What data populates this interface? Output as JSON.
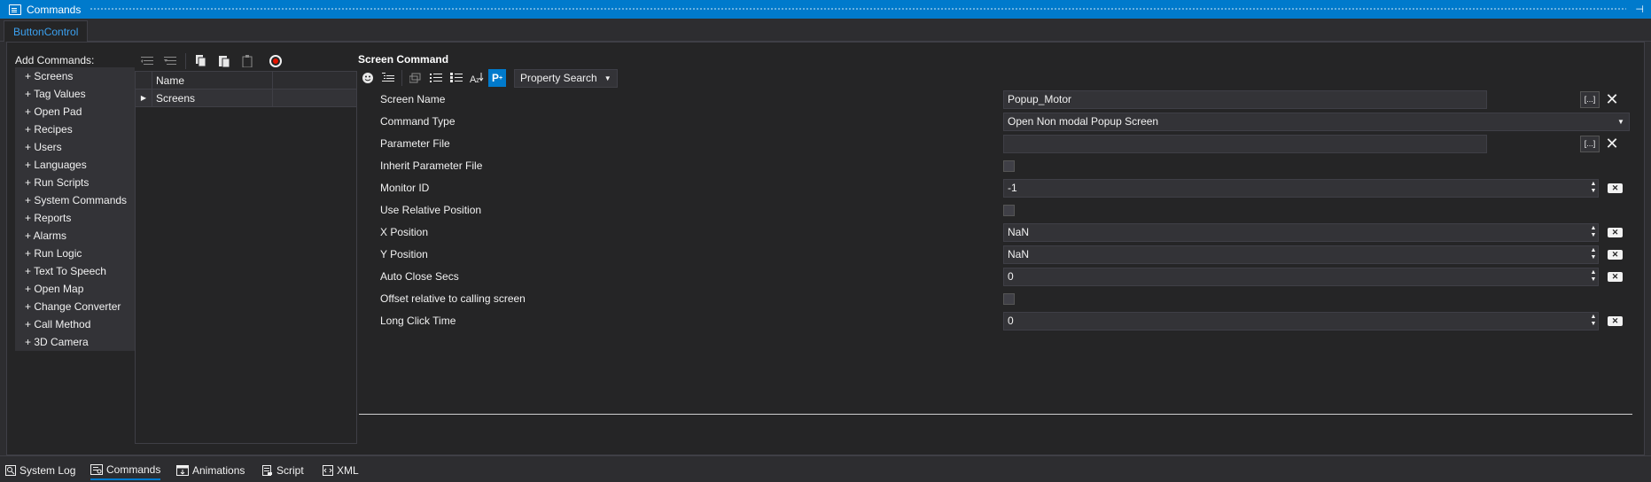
{
  "window": {
    "title": "Commands",
    "pin_glyph": "⊣"
  },
  "tabs": {
    "active": "ButtonControl"
  },
  "left": {
    "add_commands_label": "Add Commands:",
    "items": [
      "+ Screens",
      "+ Tag Values",
      "+ Open Pad",
      "+ Recipes",
      "+ Users",
      "+ Languages",
      "+ Run Scripts",
      "+ System Commands",
      "+ Reports",
      "+ Alarms",
      "+ Run Logic",
      "+ Text To Speech",
      "+ Open Map",
      "+ Change Converter",
      "+ Call Method",
      "+ 3D Camera"
    ]
  },
  "grid": {
    "header": "Name",
    "rows": [
      {
        "expander": "▶",
        "name": "Screens"
      }
    ]
  },
  "editor": {
    "title": "Screen Command",
    "property_search_label": "Property Search",
    "sort_glyph": "P",
    "properties": [
      {
        "label": "Screen Name",
        "value": "Popup_Motor"
      },
      {
        "label": "Command Type",
        "value": "Open Non modal Popup Screen"
      },
      {
        "label": "Parameter File",
        "value": ""
      },
      {
        "label": "Inherit Parameter File",
        "value": ""
      },
      {
        "label": "Monitor ID",
        "value": "-1"
      },
      {
        "label": "Use Relative Position",
        "value": ""
      },
      {
        "label": "X Position",
        "value": "NaN"
      },
      {
        "label": "Y Position",
        "value": "NaN"
      },
      {
        "label": "Auto Close Secs",
        "value": "0"
      },
      {
        "label": "Offset relative to calling screen",
        "value": ""
      },
      {
        "label": "Long Click Time",
        "value": "0"
      }
    ],
    "ellipsis_label": "[...]"
  },
  "bottom_tabs": [
    {
      "label": "System Log",
      "icon": "search-icon"
    },
    {
      "label": "Commands",
      "icon": "commands-icon"
    },
    {
      "label": "Animations",
      "icon": "animations-icon"
    },
    {
      "label": "Script",
      "icon": "script-icon"
    },
    {
      "label": "XML",
      "icon": "xml-icon"
    }
  ],
  "colors": {
    "accent": "#007acc",
    "background": "#252526",
    "panel": "#2d2d30",
    "record": "#e51400"
  }
}
